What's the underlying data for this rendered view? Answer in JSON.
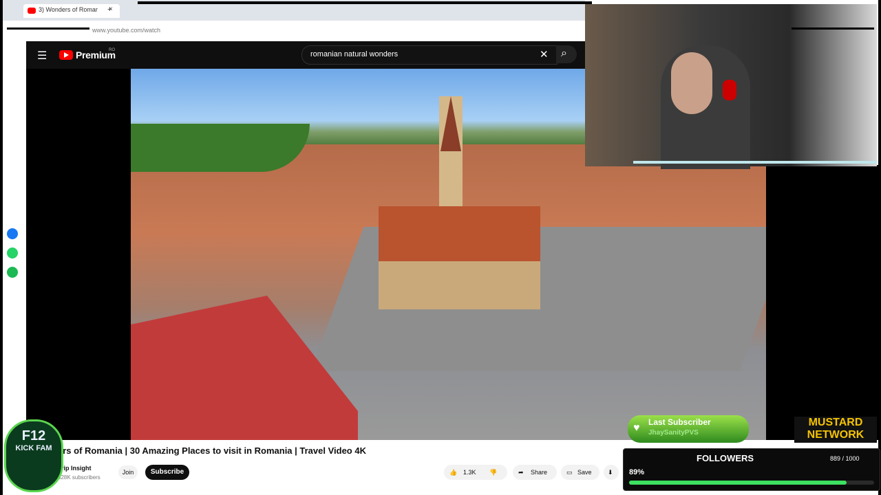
{
  "browser": {
    "tab_title": "3) Wonders of Romar",
    "new_tab": "+",
    "url": "www.youtube.com/watch"
  },
  "youtube": {
    "menu_icon": "☰",
    "logo_text": "Premium",
    "logo_region": "RO",
    "search_query": "romanian natural wonders",
    "clear_icon": "✕",
    "search_icon": "⌕"
  },
  "video": {
    "title": "ers of Romania  |  30 Amazing Places to visit in Romania  |  Travel Video 4K",
    "channel": "Trip Insight",
    "subscribers": "628K subscribers",
    "join_label": "Join",
    "subscribe_label": "Subscribe",
    "likes": "1.3K",
    "share_label": "Share",
    "save_label": "Save"
  },
  "overlay": {
    "f12_line1": "F12",
    "f12_line2": "KICK FAM",
    "last_subscriber_title": "Last Subscriber",
    "last_subscriber_name": "JhaySanityPVS",
    "mustard_line1": "MUSTARD",
    "mustard_line2": "NETWORK",
    "followers_label": "FOLLOWERS",
    "followers_count": "889 / 1000",
    "followers_percent_text": "89%",
    "followers_progress": 0.889
  },
  "colors": {
    "youtube_red": "#ff0000",
    "progress_green": "#3de060",
    "mustard": "#f5c400"
  }
}
